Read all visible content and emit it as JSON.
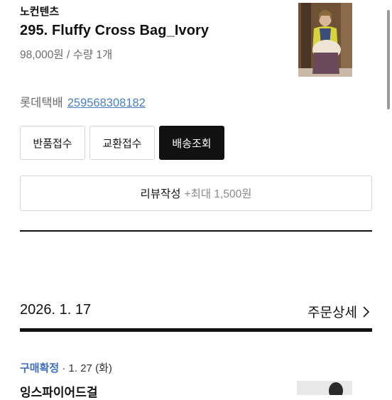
{
  "order_item": {
    "brand": "노컨텐츠",
    "title": "295. Fluffy Cross Bag_Ivory",
    "price_quantity": "98,000원 / 수량 1개",
    "carrier": "롯데택배",
    "tracking_number": "259568308182"
  },
  "actions": {
    "return_label": "반품접수",
    "exchange_label": "교환접수",
    "delivery_label": "배송조회"
  },
  "review": {
    "label": "리뷰작성",
    "reward": "+최대 1,500원"
  },
  "order_group": {
    "date": "2026. 1. 17",
    "detail_link": "주문상세"
  },
  "next_item": {
    "status": "구매확정",
    "date_text": "· 1. 27 (화)",
    "seller": "잉스파이어드걸"
  },
  "colors": {
    "accent_blue": "#3f6fb8",
    "link_blue": "#4a7fbf",
    "primary": "#111111"
  }
}
